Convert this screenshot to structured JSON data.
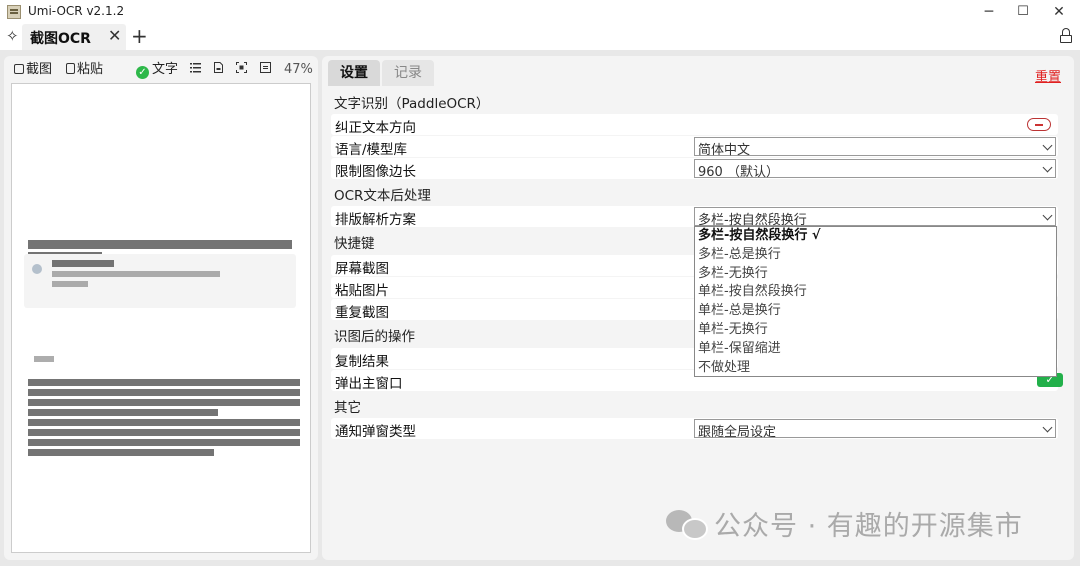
{
  "window": {
    "title": "Umi-OCR v2.1.2",
    "minimize_glyph": "─",
    "maximize_glyph": "☐",
    "close_glyph": "✕"
  },
  "tabs": {
    "pin_glyph": "✧",
    "active_tab": "截图OCR",
    "close_glyph": "✕",
    "add_glyph": "+"
  },
  "left_toolbar": {
    "screenshot": "截图",
    "paste": "粘贴",
    "text_label": "文字",
    "zoom": "47%"
  },
  "right_tabs": {
    "settings": "设置",
    "records": "记录",
    "reset": "重置"
  },
  "settings": {
    "section_ocr": "文字识别（PaddleOCR）",
    "correct_orientation": "纠正文本方向",
    "language_label": "语言/模型库",
    "language_value": "简体中文",
    "limit_side_label": "限制图像边长",
    "limit_side_value": "960 （默认）",
    "section_post": "OCR文本后处理",
    "layout_label": "排版解析方案",
    "layout_value": "多栏-按自然段换行",
    "section_hotkeys": "快捷键",
    "screen_capture": "屏幕截图",
    "paste_image": "粘贴图片",
    "repeat_capture": "重复截图",
    "section_after": "识图后的操作",
    "copy_result": "复制结果",
    "popup_window": "弹出主窗口",
    "section_other": "其它",
    "notify_type_label": "通知弹窗类型",
    "notify_type_value": "跟随全局设定"
  },
  "layout_options": [
    "多栏-按自然段换行 √",
    "多栏-总是换行",
    "多栏-无换行",
    "单栏-按自然段换行",
    "单栏-总是换行",
    "单栏-无换行",
    "单栏-保留缩进",
    "不做处理"
  ],
  "watermark": "公众号 · 有趣的开源集市",
  "colors": {
    "reset": "#e02020",
    "toggle_on": "#22b04a",
    "check": "#2eb84a"
  },
  "icons": [
    "pin-icon",
    "lock-icon",
    "screenshot-icon",
    "paste-icon",
    "check-icon",
    "list-icon",
    "doc-icon",
    "fit-icon",
    "grid-icon"
  ]
}
